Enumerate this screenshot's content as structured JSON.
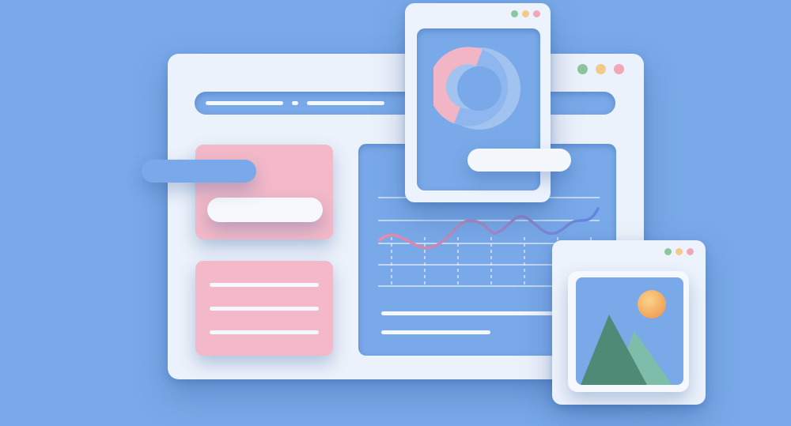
{
  "colors": {
    "background": "#79a9e8",
    "window": "#ecf2fb",
    "pink_card": "#f4b9c8",
    "dot_green": "#8cc6a0",
    "dot_yellow": "#f3c98c",
    "dot_pink": "#f2a7b9",
    "donut_pink": "#f2b5c6",
    "donut_blue": "#8fb6ef",
    "wave_start": "#f08aa3",
    "wave_end": "#5d86e3",
    "mountain_dark": "#4e8a76",
    "mountain_light": "#7dbdaa",
    "sun": "#f6b766"
  },
  "icons": {
    "window_controls": [
      "green-dot",
      "yellow-dot",
      "pink-dot"
    ],
    "donut_chart": "donut-chart-icon",
    "line_chart": "line-chart-icon",
    "image": "image-landscape-icon"
  },
  "illustration": {
    "donut_chart": {
      "pink_fraction": 0.55,
      "blue_fraction": 0.45
    },
    "text_lines_pink_card": 3,
    "text_lines_chart_panel": 2
  }
}
